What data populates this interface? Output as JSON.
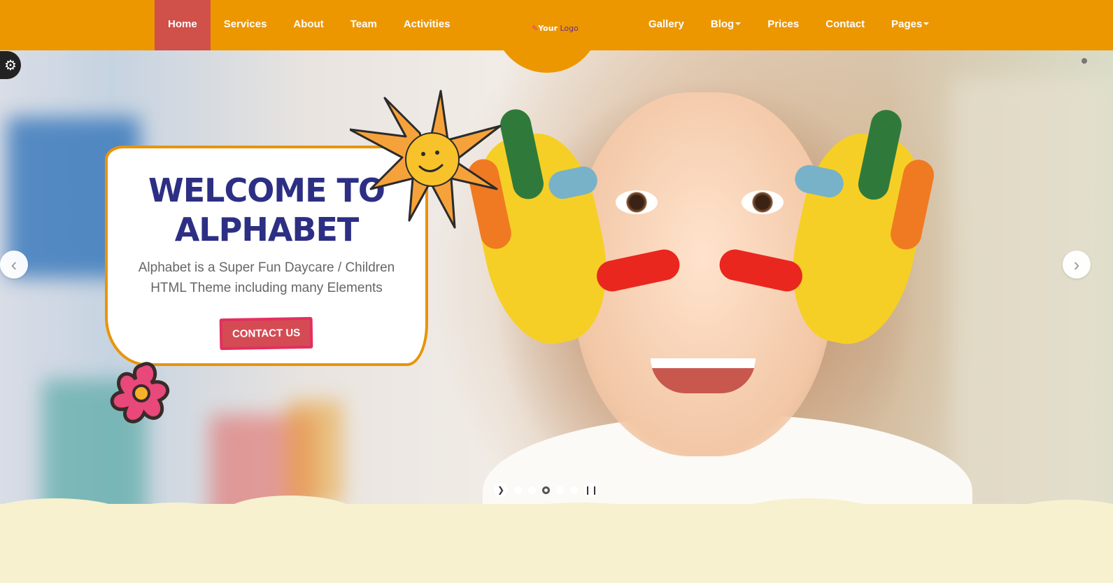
{
  "nav": {
    "left_items": [
      {
        "label": "Home",
        "active": true
      },
      {
        "label": "Services"
      },
      {
        "label": "About"
      },
      {
        "label": "Team"
      },
      {
        "label": "Activities"
      }
    ],
    "right_items": [
      {
        "label": "Gallery"
      },
      {
        "label": "Blog",
        "dropdown": true
      },
      {
        "label": "Prices"
      },
      {
        "label": "Contact"
      },
      {
        "label": "Pages",
        "dropdown": true
      }
    ],
    "logo": {
      "word1": "Your",
      "word2": "Logo"
    }
  },
  "hero": {
    "title_line1": "WELCOME TO",
    "title_line2": "ALPHABET",
    "description": "Alphabet is a Super Fun Daycare / Children HTML Theme including many Elements",
    "cta_label": "CONTACT US"
  },
  "slider": {
    "slide_count": 5,
    "active_slide": 3,
    "prev_icon": "chevron-left-icon",
    "next_icon": "chevron-right-icon"
  },
  "colors": {
    "navbar": "#ec9700",
    "active_nav": "#d0504a",
    "title": "#2c2f83",
    "cta": "#e2305f",
    "footer": "#f7f1cf"
  }
}
